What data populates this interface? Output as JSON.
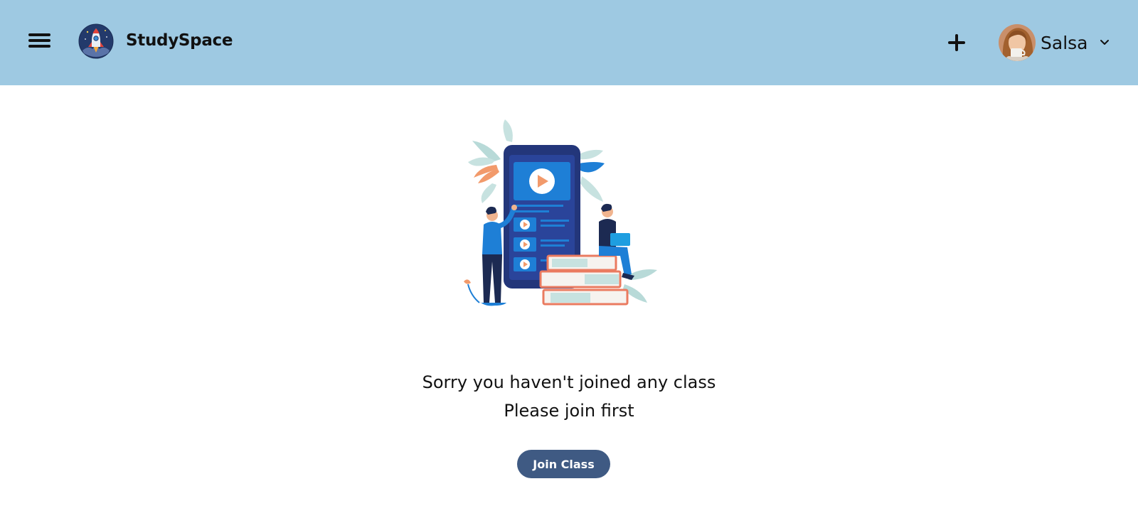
{
  "header": {
    "menu_icon": "hamburger-menu-icon",
    "logo_icon": "rocket-logo-icon",
    "brand": "StudySpace",
    "add_icon": "plus-icon",
    "user": {
      "name": "Salsa",
      "avatar_icon": "user-avatar",
      "dropdown_icon": "chevron-down-icon"
    }
  },
  "main": {
    "illustration": "online-learning-illustration",
    "message_line1": "Sorry you haven't joined any class",
    "message_line2": "Please join first",
    "join_button_label": "Join Class"
  },
  "colors": {
    "header_bg": "#9ec9e2",
    "button_bg": "#3f5a83",
    "text": "#111111"
  }
}
